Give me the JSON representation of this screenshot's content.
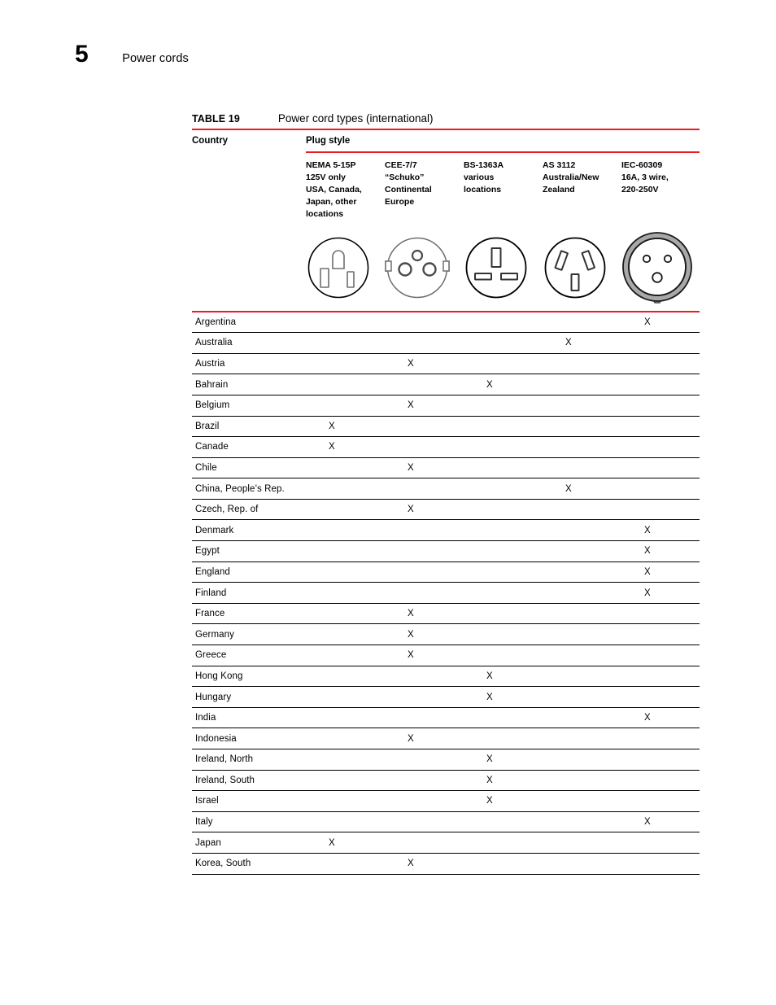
{
  "page": {
    "chapter_number": "5",
    "chapter_title": "Power cords"
  },
  "table": {
    "caption_label": "TABLE 19",
    "caption_text": "Power cord types (international)",
    "header_country": "Country",
    "header_plug_style": "Plug style",
    "accent_color": "#ed1c24",
    "columns": [
      {
        "id": "nema-5-15p",
        "lines": [
          "NEMA 5-15P",
          "125V only",
          "USA, Canada,",
          "Japan, other",
          "locations"
        ],
        "icon": "nema-5-15p-plug-icon"
      },
      {
        "id": "cee-7-7",
        "lines": [
          "CEE-7/7",
          "“Schuko”",
          "Continental",
          "Europe"
        ],
        "icon": "cee-7-7-schuko-plug-icon"
      },
      {
        "id": "bs-1363a",
        "lines": [
          "BS-1363A",
          "various",
          "locations"
        ],
        "icon": "bs-1363a-plug-icon"
      },
      {
        "id": "as-3112",
        "lines": [
          "AS 3112",
          "Australia/New",
          "Zealand"
        ],
        "icon": "as-3112-plug-icon"
      },
      {
        "id": "iec-60309",
        "lines": [
          "IEC-60309",
          "16A, 3 wire,",
          "220-250V"
        ],
        "icon": "iec-60309-plug-icon"
      }
    ],
    "mark": "X",
    "rows": [
      {
        "country": "Argentina",
        "marks": [
          "",
          "",
          "",
          "",
          "X"
        ]
      },
      {
        "country": "Australia",
        "marks": [
          "",
          "",
          "",
          "X",
          ""
        ]
      },
      {
        "country": "Austria",
        "marks": [
          "",
          "X",
          "",
          "",
          ""
        ]
      },
      {
        "country": "Bahrain",
        "marks": [
          "",
          "",
          "X",
          "",
          ""
        ]
      },
      {
        "country": "Belgium",
        "marks": [
          "",
          "X",
          "",
          "",
          ""
        ]
      },
      {
        "country": "Brazil",
        "marks": [
          "X",
          "",
          "",
          "",
          ""
        ]
      },
      {
        "country": "Canade",
        "marks": [
          "X",
          "",
          "",
          "",
          ""
        ]
      },
      {
        "country": "Chile",
        "marks": [
          "",
          "X",
          "",
          "",
          ""
        ]
      },
      {
        "country": "China, People’s Rep.",
        "marks": [
          "",
          "",
          "",
          "X",
          ""
        ]
      },
      {
        "country": "Czech, Rep. of",
        "marks": [
          "",
          "X",
          "",
          "",
          ""
        ]
      },
      {
        "country": "Denmark",
        "marks": [
          "",
          "",
          "",
          "",
          "X"
        ]
      },
      {
        "country": "Egypt",
        "marks": [
          "",
          "",
          "",
          "",
          "X"
        ]
      },
      {
        "country": "England",
        "marks": [
          "",
          "",
          "",
          "",
          "X"
        ]
      },
      {
        "country": "Finland",
        "marks": [
          "",
          "",
          "",
          "",
          "X"
        ]
      },
      {
        "country": "France",
        "marks": [
          "",
          "X",
          "",
          "",
          ""
        ]
      },
      {
        "country": "Germany",
        "marks": [
          "",
          "X",
          "",
          "",
          ""
        ]
      },
      {
        "country": "Greece",
        "marks": [
          "",
          "X",
          "",
          "",
          ""
        ]
      },
      {
        "country": "Hong Kong",
        "marks": [
          "",
          "",
          "X",
          "",
          ""
        ]
      },
      {
        "country": "Hungary",
        "marks": [
          "",
          "",
          "X",
          "",
          ""
        ]
      },
      {
        "country": "India",
        "marks": [
          "",
          "",
          "",
          "",
          "X"
        ]
      },
      {
        "country": "Indonesia",
        "marks": [
          "",
          "X",
          "",
          "",
          ""
        ]
      },
      {
        "country": "Ireland, North",
        "marks": [
          "",
          "",
          "X",
          "",
          ""
        ]
      },
      {
        "country": "Ireland, South",
        "marks": [
          "",
          "",
          "X",
          "",
          ""
        ]
      },
      {
        "country": "Israel",
        "marks": [
          "",
          "",
          "X",
          "",
          ""
        ]
      },
      {
        "country": "Italy",
        "marks": [
          "",
          "",
          "",
          "",
          "X"
        ]
      },
      {
        "country": "Japan",
        "marks": [
          "X",
          "",
          "",
          "",
          ""
        ]
      },
      {
        "country": "Korea, South",
        "marks": [
          "",
          "X",
          "",
          "",
          ""
        ]
      }
    ]
  }
}
